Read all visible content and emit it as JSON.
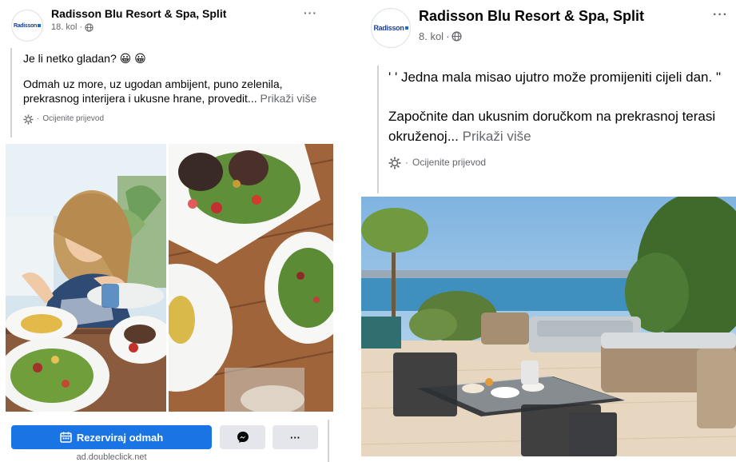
{
  "left_post": {
    "page_name": "Radisson Blu Resort & Spa, Split",
    "avatar_text": "Radisson",
    "timestamp": "18. kol",
    "more_label": "···",
    "line1": "Je li netko gladan? 😀 😀",
    "body": "Odmah uz more, uz ugodan ambijent, puno zelenila, prekrasnog interijera i ukusne hrane, provedit...",
    "see_more": "Prikaži više",
    "translate_label": "Ocijenite prijevod",
    "cta_label": "Rezerviraj odmah",
    "ad_domain": "ad.doubleclick.net",
    "more_button_label": "···"
  },
  "right_post": {
    "page_name": "Radisson Blu Resort & Spa, Split",
    "avatar_text": "Radisson",
    "timestamp": "8. kol",
    "more_label": "···",
    "quote": "' ' Jedna mala misao ujutro može promijeniti cijeli dan. \"",
    "body": "Započnite dan ukusnim doručkom na prekrasnoj terasi okruženoj...",
    "see_more": "Prikaži više",
    "translate_label": "Ocijenite prijevod"
  },
  "colors": {
    "cta_blue": "#1b74e4",
    "secondary_text": "#65676b",
    "button_gray": "#e4e6eb",
    "logo_blue": "#1c3f94"
  },
  "icons": [
    "globe-icon",
    "gear-icon",
    "calendar-icon",
    "messenger-icon",
    "more-dots-icon"
  ]
}
